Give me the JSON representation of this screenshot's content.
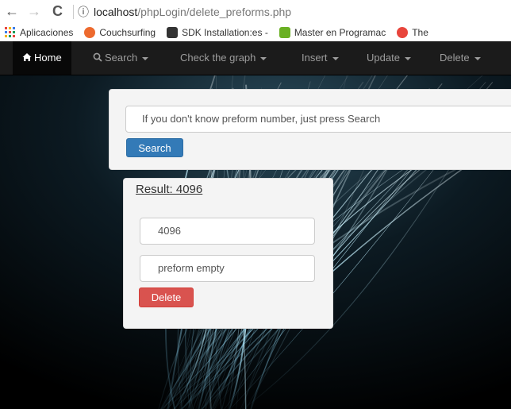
{
  "browser": {
    "back_icon": "←",
    "forward_icon": "→",
    "reload_icon": "C",
    "info_icon": "ⓘ",
    "url_host": "localhost",
    "url_path": "/phpLogin/delete_preforms.php"
  },
  "bookmarks": [
    {
      "label": "Aplicaciones",
      "icon": "apps-icon",
      "color": "#e8453c"
    },
    {
      "label": "Couchsurfing",
      "icon": "couchsurfing-icon",
      "color": "#ed6a2e"
    },
    {
      "label": "SDK Installation:es -",
      "icon": "sdk-icon",
      "color": "#333333"
    },
    {
      "label": "Master en Programac",
      "icon": "master-icon",
      "color": "#6ab023"
    },
    {
      "label": "The",
      "icon": "cp-icon",
      "color": "#e8453c"
    }
  ],
  "navbar": {
    "home": "Home",
    "items": [
      "Search",
      "Check the graph",
      "Insert",
      "Update",
      "Delete"
    ]
  },
  "search": {
    "placeholder": "If you don't know preform number, just press Search",
    "button": "Search"
  },
  "result": {
    "title": "Result: 4096",
    "number_value": "4096",
    "status_value": "preform empty",
    "delete_button": "Delete"
  },
  "colors": {
    "navbar_bg": "#1b1b1b",
    "primary": "#337ab7",
    "danger": "#d9534f",
    "panel_bg": "#f4f4f4"
  }
}
